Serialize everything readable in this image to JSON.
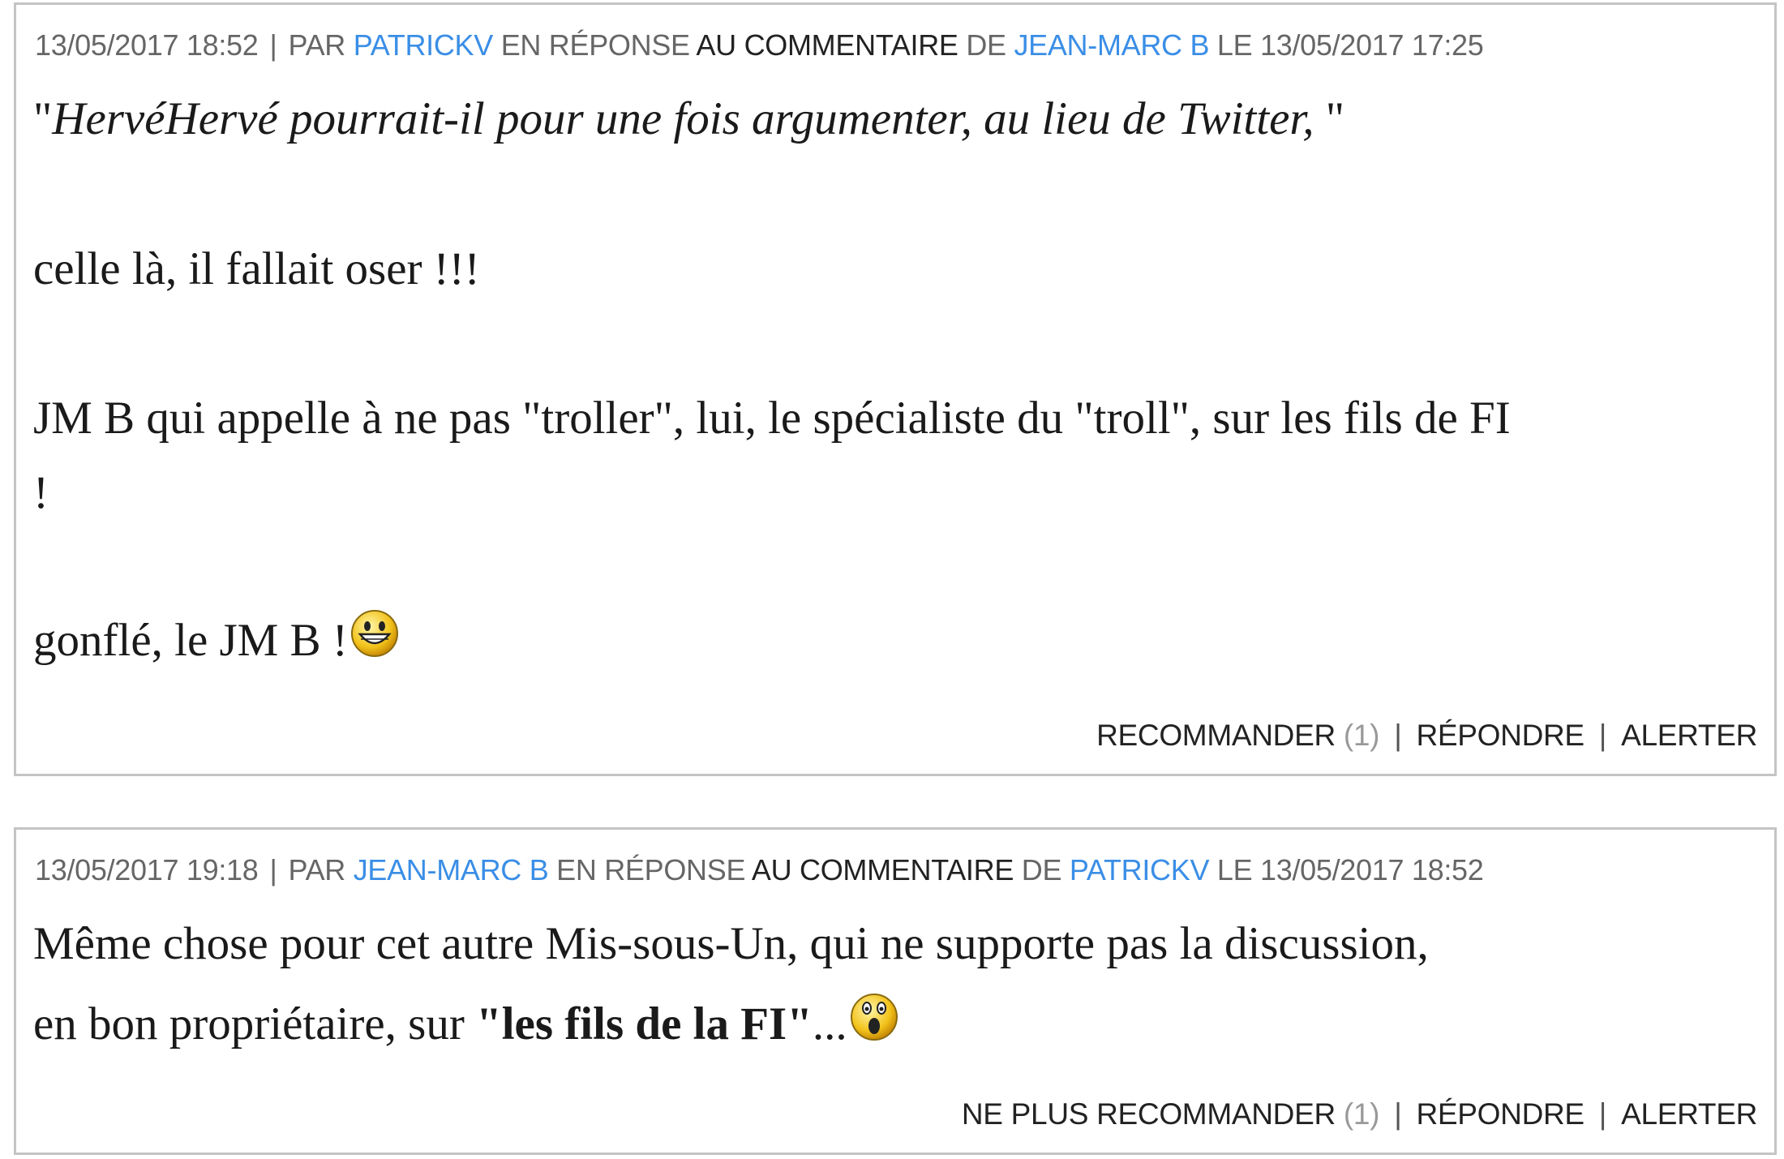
{
  "comments": [
    {
      "date": "13/05/2017 18:52",
      "par": "PAR",
      "author": "PATRICKV",
      "en_reponse": "EN RÉPONSE",
      "au_commentaire": "AU COMMENTAIRE",
      "de": "DE",
      "parent_author": "JEAN-MARC B",
      "le": "LE",
      "parent_date": "13/05/2017 17:25",
      "body": {
        "quote_open": "\"",
        "quote_text": "HervéHervé pourrait-il pour une fois argumenter, au lieu de Twitter, ",
        "quote_close": "\"",
        "line2": "celle là, il fallait oser !!!",
        "line3": "JM B qui appelle à ne pas \"troller\", lui, le spécialiste du \"troll\", sur les fils de FI",
        "line4": "!",
        "line5": "gonflé, le JM B !"
      },
      "emoji": "smiley-grin-icon",
      "actions": {
        "recommend": "RECOMMANDER",
        "recommend_count": "(1)",
        "reply": "RÉPONDRE",
        "alert": "ALERTER"
      }
    },
    {
      "date": "13/05/2017 19:18",
      "par": "PAR",
      "author": "JEAN-MARC B",
      "en_reponse": "EN RÉPONSE",
      "au_commentaire": "AU COMMENTAIRE",
      "de": "DE",
      "parent_author": "PATRICKV",
      "le": "LE",
      "parent_date": "13/05/2017 18:52",
      "body": {
        "line1": "Même chose pour cet autre Mis-sous-Un, qui ne supporte pas la discussion,",
        "line2_a": "en bon propriétaire,  sur ",
        "line2_bold": "\"les fils de la FI\"",
        "line2_end": "..."
      },
      "emoji": "smiley-surprised-icon",
      "actions": {
        "recommend": "NE PLUS RECOMMANDER",
        "recommend_count": "(1)",
        "reply": "RÉPONDRE",
        "alert": "ALERTER"
      }
    }
  ],
  "colors": {
    "link": "#3a8ee6",
    "meta": "#666666",
    "border": "#c4c4c4",
    "text": "#1a1a1a"
  }
}
